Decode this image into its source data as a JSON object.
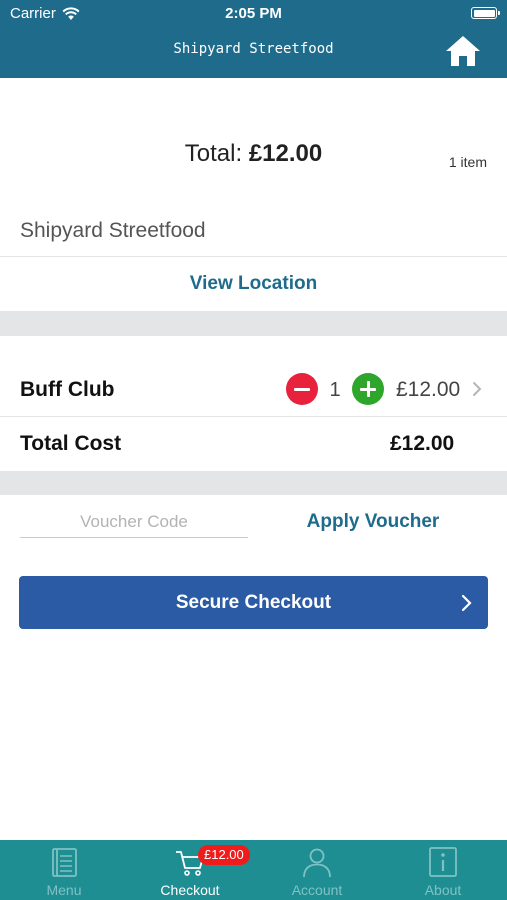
{
  "status_bar": {
    "carrier": "Carrier",
    "time": "2:05 PM"
  },
  "header": {
    "title": "Shipyard Streetfood"
  },
  "summary": {
    "total_label": "Total:",
    "total_amount": "£12.00",
    "item_count": "1 item"
  },
  "store": {
    "name": "Shipyard Streetfood",
    "view_location_label": "View Location"
  },
  "basket": {
    "items": [
      {
        "name": "Buff Club",
        "quantity": "1",
        "price": "£12.00"
      }
    ],
    "total_cost_label": "Total Cost",
    "total_cost_value": "£12.00"
  },
  "voucher": {
    "placeholder": "Voucher Code",
    "apply_label": "Apply Voucher"
  },
  "checkout": {
    "label": "Secure Checkout"
  },
  "tabs": [
    {
      "label": "Menu",
      "icon": "menu-book-icon",
      "active": false
    },
    {
      "label": "Checkout",
      "icon": "cart-icon",
      "active": true,
      "badge": "£12.00"
    },
    {
      "label": "Account",
      "icon": "person-icon",
      "active": false
    },
    {
      "label": "About",
      "icon": "info-icon",
      "active": false
    }
  ],
  "colors": {
    "header": "#1f6b8c",
    "link": "#1f6b8c",
    "checkout_button": "#2a5ba4",
    "tab_bar": "#1f8e93",
    "minus": "#e8213d",
    "plus": "#2ea52b",
    "badge": "#f01b1b"
  }
}
